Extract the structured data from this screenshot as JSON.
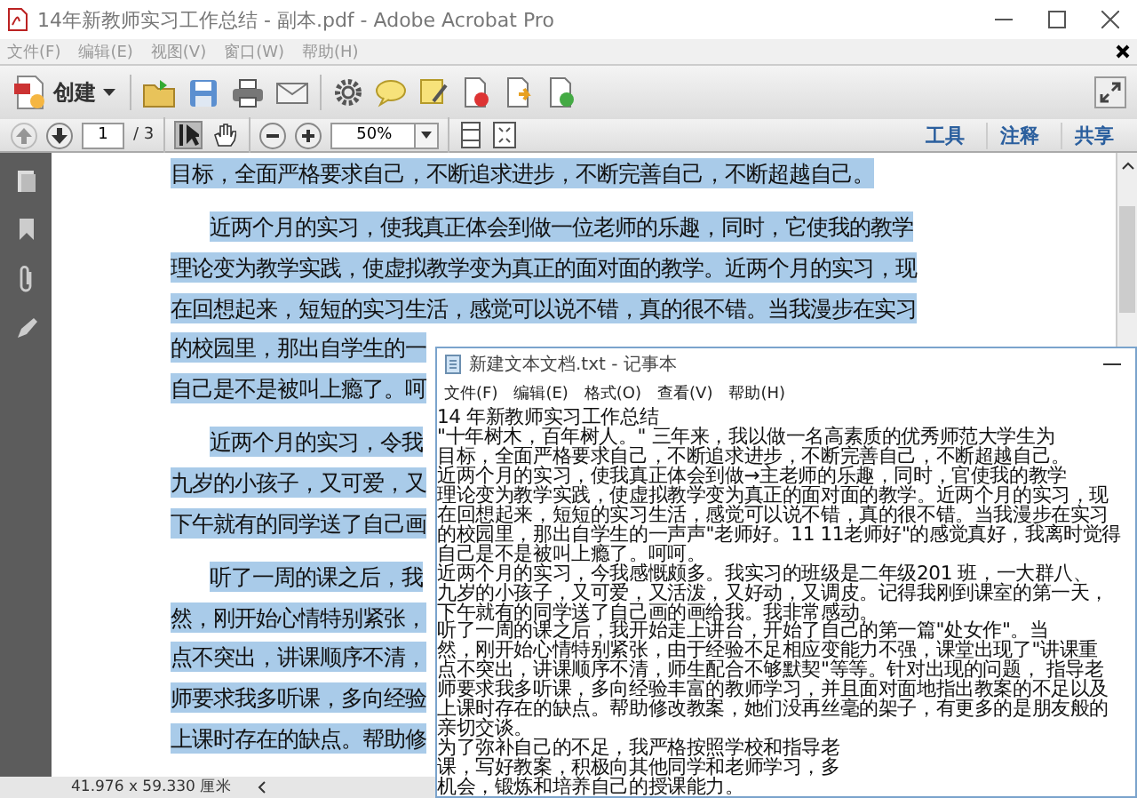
{
  "acrobat": {
    "title": "14年新教师实习工作总结 - 副本.pdf - Adobe Acrobat Pro",
    "menu": [
      "文件(F)",
      "编辑(E)",
      "视图(V)",
      "窗口(W)",
      "帮助(H)"
    ],
    "toolbar": {
      "create_label": "创建"
    },
    "nav": {
      "prev_disabled": true,
      "next_disabled": false,
      "page": "1",
      "page_total": "/ 3",
      "zoom": "50%",
      "tools": [
        {
          "kind": "select",
          "selected": true
        },
        {
          "kind": "hand",
          "selected": false
        }
      ]
    },
    "panes": [
      "工具",
      "注释",
      "共享"
    ],
    "document": [
      {
        "kind": "line",
        "text": "目标，全面严格要求自己，不断追求进步，不断完善自己，不断超越自己。"
      },
      {
        "kind": "first",
        "text": "近两个月的实习，使我真正体会到做一位老师的乐趣，同时，它使我的教学"
      },
      {
        "kind": "line",
        "text": "理论变为教学实践，使虚拟教学变为真正的面对面的教学。近两个月的实习，现"
      },
      {
        "kind": "line",
        "text": "在回想起来，短短的实习生活，感觉可以说不错，真的很不错。当我漫步在实习"
      },
      {
        "kind": "line",
        "text": "的校园里，那出自学生的一"
      },
      {
        "kind": "line",
        "text": "自己是不是被叫上瘾了。呵"
      },
      {
        "kind": "first",
        "text": "近两个月的实习，令我"
      },
      {
        "kind": "line",
        "text": "九岁的小孩子，又可爱，又"
      },
      {
        "kind": "line",
        "text": "下午就有的同学送了自己画"
      },
      {
        "kind": "first",
        "text": "听了一周的课之后，我"
      },
      {
        "kind": "line",
        "text": "然，刚开始心情特别紧张，"
      },
      {
        "kind": "line",
        "text": "点不突出，讲课顺序不清，"
      },
      {
        "kind": "line",
        "text": "师要求我多听课，多向经验"
      },
      {
        "kind": "line",
        "text": "上课时存在的缺点。帮助修"
      }
    ],
    "status": "41.976 x 59.330 厘米"
  },
  "notepad": {
    "title": "新建文本文档.txt - 记事本",
    "menu": [
      "文件(F)",
      "编辑(E)",
      "格式(O)",
      "查看(V)",
      "帮助(H)"
    ],
    "lines": [
      "14 年新教师实习工作总结",
      "\"十年树木，百年树人。\" 三年来，我以做一名高素质的优秀师范大学生为",
      "目标，全面严格要求自己，不断追求进步，不断完善自己，不断超越自己。",
      "近两个月的实习，使我真正体会到做→主老师的乐趣，同时，官使我的教学",
      "理论变为教学实践，使虚拟教学变为真正的面对面的教学。近两个月的实习，现",
      "在回想起来，短短的实习生活，感觉可以说不错，真的很不错。当我漫步在实习",
      "的校园里，那出自学生的一声声\"老师好。11 11老师好\"的感觉真好，我离时觉得",
      "自己是不是被叫上瘾了。呵呵。",
      "近两个月的实习，今我感慨颇多。我实习的班级是二年级201 班，一大群八、",
      "九岁的小孩子，又可爱，又活泼，又好动，又调皮。记得我刚到课室的第一天，",
      "下午就有的同学送了自己画的画给我。我非常感动。",
      "听了一周的课之后，我开始走上讲台，开始了自己的第一篇\"处女作\"。当",
      "然，刚开始心情特别紧张，由于经验不足相应变能力不强，课堂出现了\"讲课重",
      "点不突出，讲课顺序不清，师生配合不够默契\"等等。针对出现的问题， 指导老",
      "师要求我多听课，多向经验丰富的教师学习，并且面对面地指出教案的不足以及",
      "上课时存在的缺点。帮助修改教案，她们没再丝毫的架子，有更多的是朋友般的",
      "亲切交谈。",
      "为了弥补自己的不足，我严格按照学校和指导老",
      "课，写好教案，积极向其他同学和老师学习，多",
      "机会，锻炼和培养自己的授课能力。"
    ]
  }
}
